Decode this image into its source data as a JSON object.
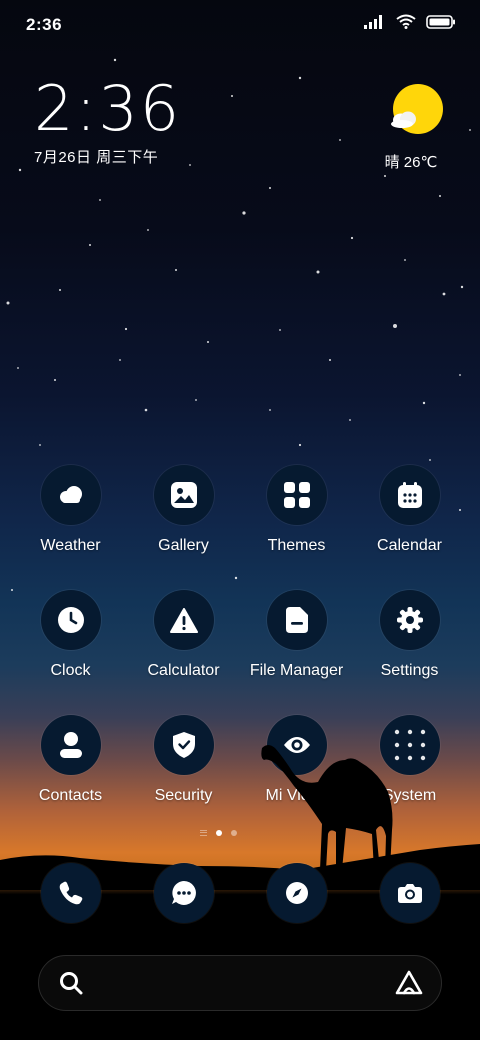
{
  "status_bar": {
    "time": "2:36",
    "icons": [
      "signal-icon",
      "wifi-icon",
      "battery-icon"
    ]
  },
  "clock_widget": {
    "time": "2:36",
    "date": "7月26日 周三下午"
  },
  "weather_widget": {
    "icon": "sun-cloud-icon",
    "text": "晴 26℃"
  },
  "apps": [
    {
      "label": "Weather",
      "icon": "cloud-icon"
    },
    {
      "label": "Gallery",
      "icon": "image-icon"
    },
    {
      "label": "Themes",
      "icon": "grid-icon"
    },
    {
      "label": "Calendar",
      "icon": "calendar-icon"
    },
    {
      "label": "Clock",
      "icon": "clock-icon"
    },
    {
      "label": "Calculator",
      "icon": "warning-icon"
    },
    {
      "label": "File Manager",
      "icon": "folder-icon"
    },
    {
      "label": "Settings",
      "icon": "gear-icon"
    },
    {
      "label": "Contacts",
      "icon": "person-icon"
    },
    {
      "label": "Security",
      "icon": "shield-icon"
    },
    {
      "label": "Mi Video",
      "icon": "eye-icon"
    },
    {
      "label": "System",
      "icon": "folder-grid-icon"
    }
  ],
  "page_indicator": {
    "pages": 2,
    "active": 1
  },
  "dock": [
    {
      "icon": "phone-icon"
    },
    {
      "icon": "chat-icon"
    },
    {
      "icon": "compass-icon"
    },
    {
      "icon": "camera-icon"
    }
  ],
  "search": {
    "icon": "search-icon",
    "assistant_icon": "ai-assistant-icon"
  },
  "colors": {
    "icon_bg": "#061a30",
    "sun": "#ffd60a",
    "sky_top": "#05070f",
    "horizon": "#d8782a"
  }
}
